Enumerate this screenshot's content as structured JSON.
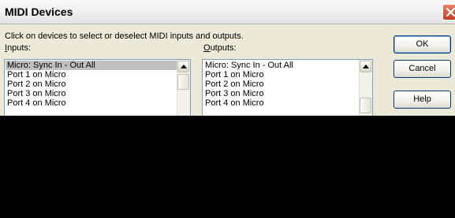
{
  "window": {
    "title": "MIDI Devices",
    "close_icon": "close-x-icon"
  },
  "instructions": "Click on devices to select or deselect MIDI inputs and outputs.",
  "inputs": {
    "label_prefix": "I",
    "label_rest": "nputs:",
    "items": [
      "Micro: Sync In - Out All",
      "Port 1 on Micro",
      "Port 2 on Micro",
      "Port 3 on Micro",
      "Port 4 on Micro"
    ],
    "selected": "Micro: Sync In - Out All"
  },
  "outputs": {
    "label_prefix": "O",
    "label_rest": "utputs:",
    "items": [
      "Micro: Sync In - Out All",
      "Port 1 on Micro",
      "Port 2 on Micro",
      "Port 3 on Micro",
      "Port 4 on Micro"
    ]
  },
  "buttons": {
    "ok": "OK",
    "cancel": "Cancel",
    "help": "Help"
  },
  "colors": {
    "dialog_bg": "#ece9d8",
    "selection": "#c0c0c0",
    "close_button": "#c8391b"
  }
}
